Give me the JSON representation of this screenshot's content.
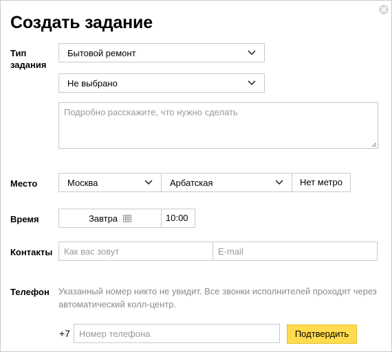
{
  "dialog": {
    "title": "Создать задание"
  },
  "task_type": {
    "label_line1": "Тип",
    "label_line2": "задания",
    "category": "Бытовой ремонт",
    "subcategory": "Не выбрано",
    "description_placeholder": "Подробно расскажите, что нужно сделать"
  },
  "place": {
    "label": "Место",
    "city": "Москва",
    "metro_station": "Арбатская",
    "no_metro": "Нет метро"
  },
  "time": {
    "label": "Время",
    "date": "Завтра",
    "clock": "10:00"
  },
  "contacts": {
    "label": "Контакты",
    "name_placeholder": "Как вас зовут",
    "email_placeholder": "E-mail"
  },
  "phone": {
    "label": "Телефон",
    "hint": "Указанный номер никто не увидит. Все звонки исполнителей проходят через автоматический колл-центр.",
    "prefix": "+7",
    "number_placeholder": "Номер телефона",
    "confirm": "Подтвердить"
  },
  "icons": {
    "close": "close-icon",
    "dropdown": "chevron-down-icon",
    "calendar": "calendar-icon"
  },
  "colors": {
    "accent": "#ffdb4d",
    "border": "#c9c9c9",
    "hint": "#8a8a8a"
  }
}
